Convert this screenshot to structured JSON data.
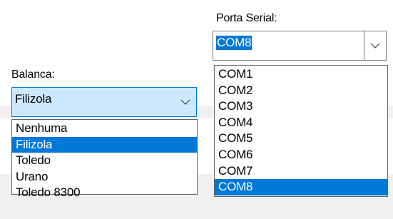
{
  "colors": {
    "accent": "#0078d7",
    "focus_background": "#cce8ff",
    "dialog_background": "#f0f0f0"
  },
  "balanca": {
    "label": "Balanca:",
    "selected_value": "Filizola",
    "dropdown_icon": "chevron-down-icon",
    "options": [
      "Nenhuma",
      "Filizola",
      "Toledo",
      "Urano",
      "Toledo 8300"
    ],
    "highlighted_index": 1
  },
  "porta_serial": {
    "label": "Porta Serial:",
    "selected_value": "COM8",
    "dropdown_icon": "chevron-down-icon",
    "options": [
      "COM1",
      "COM2",
      "COM3",
      "COM4",
      "COM5",
      "COM6",
      "COM7",
      "COM8"
    ],
    "highlighted_index": 7
  }
}
